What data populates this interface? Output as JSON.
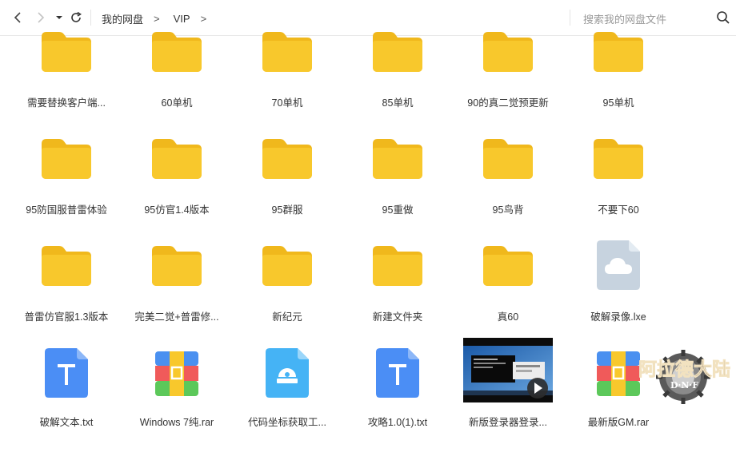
{
  "toolbar": {
    "breadcrumb": [
      "我的网盘",
      "VIP"
    ],
    "breadcrumb_separator": ">",
    "search_placeholder": "搜索我的网盘文件"
  },
  "colors": {
    "folder": "#f8c82c",
    "folder_tab": "#f0b81c",
    "doc_blue": "#4b8ef5",
    "archive_red": "#f05a5a",
    "archive_green": "#5cc85a",
    "archive_blue": "#4a90f0",
    "archive_yellow": "#f8c82c",
    "tool_blue": "#45b3f5",
    "cloud_grey": "#c7d3df"
  },
  "files": [
    {
      "name": "需要替换客户端...",
      "type": "folder"
    },
    {
      "name": "60单机",
      "type": "folder"
    },
    {
      "name": "70单机",
      "type": "folder"
    },
    {
      "name": "85单机",
      "type": "folder"
    },
    {
      "name": "90的真二觉预更新",
      "type": "folder"
    },
    {
      "name": "95单机",
      "type": "folder"
    },
    {
      "name": "95防国服普雷体验",
      "type": "folder"
    },
    {
      "name": "95仿官1.4版本",
      "type": "folder"
    },
    {
      "name": "95群服",
      "type": "folder"
    },
    {
      "name": "95重做",
      "type": "folder"
    },
    {
      "name": "95鸟背",
      "type": "folder"
    },
    {
      "name": "不要下60",
      "type": "folder"
    },
    {
      "name": "普雷仿官服1.3版本",
      "type": "folder"
    },
    {
      "name": "完美二觉+普雷修...",
      "type": "folder"
    },
    {
      "name": "新纪元",
      "type": "folder"
    },
    {
      "name": "新建文件夹",
      "type": "folder"
    },
    {
      "name": "真60",
      "type": "folder"
    },
    {
      "name": "破解录像.lxe",
      "type": "cloud-file"
    },
    {
      "name": "破解文本.txt",
      "type": "text"
    },
    {
      "name": "Windows 7纯.rar",
      "type": "archive"
    },
    {
      "name": "代码坐标获取工...",
      "type": "tool"
    },
    {
      "name": "攻略1.0(1).txt",
      "type": "text"
    },
    {
      "name": "新版登录器登录...",
      "type": "video"
    },
    {
      "name": "最新版GM.rar",
      "type": "archive"
    }
  ],
  "watermark": {
    "text": "阿拉德大陆",
    "sub": "D·N·F"
  }
}
